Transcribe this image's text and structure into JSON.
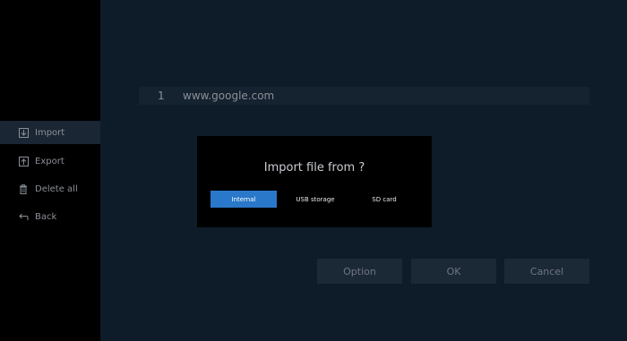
{
  "sidebar": {
    "items": [
      {
        "label": "Import",
        "icon": "import-icon"
      },
      {
        "label": "Export",
        "icon": "export-icon"
      },
      {
        "label": "Delete all",
        "icon": "trash-icon"
      },
      {
        "label": "Back",
        "icon": "back-icon"
      }
    ]
  },
  "list": {
    "rows": [
      {
        "index": "1",
        "url": "www.google.com"
      }
    ]
  },
  "dialog": {
    "title": "Import file from ?",
    "options": [
      {
        "label": "Internal",
        "selected": true
      },
      {
        "label": "USB storage",
        "selected": false
      },
      {
        "label": "SD card",
        "selected": false
      }
    ]
  },
  "actions": {
    "option": "Option",
    "ok": "OK",
    "cancel": "Cancel"
  },
  "colors": {
    "background": "#0e1b29",
    "sidebar": "#000000",
    "accent": "#2a78c9"
  }
}
